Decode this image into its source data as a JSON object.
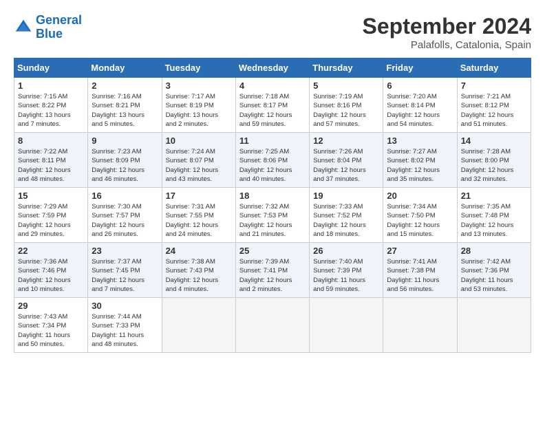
{
  "header": {
    "logo_line1": "General",
    "logo_line2": "Blue",
    "month": "September 2024",
    "location": "Palafolls, Catalonia, Spain"
  },
  "days_of_week": [
    "Sunday",
    "Monday",
    "Tuesday",
    "Wednesday",
    "Thursday",
    "Friday",
    "Saturday"
  ],
  "weeks": [
    [
      {
        "num": "1",
        "info": "Sunrise: 7:15 AM\nSunset: 8:22 PM\nDaylight: 13 hours\nand 7 minutes."
      },
      {
        "num": "2",
        "info": "Sunrise: 7:16 AM\nSunset: 8:21 PM\nDaylight: 13 hours\nand 5 minutes."
      },
      {
        "num": "3",
        "info": "Sunrise: 7:17 AM\nSunset: 8:19 PM\nDaylight: 13 hours\nand 2 minutes."
      },
      {
        "num": "4",
        "info": "Sunrise: 7:18 AM\nSunset: 8:17 PM\nDaylight: 12 hours\nand 59 minutes."
      },
      {
        "num": "5",
        "info": "Sunrise: 7:19 AM\nSunset: 8:16 PM\nDaylight: 12 hours\nand 57 minutes."
      },
      {
        "num": "6",
        "info": "Sunrise: 7:20 AM\nSunset: 8:14 PM\nDaylight: 12 hours\nand 54 minutes."
      },
      {
        "num": "7",
        "info": "Sunrise: 7:21 AM\nSunset: 8:12 PM\nDaylight: 12 hours\nand 51 minutes."
      }
    ],
    [
      {
        "num": "8",
        "info": "Sunrise: 7:22 AM\nSunset: 8:11 PM\nDaylight: 12 hours\nand 48 minutes."
      },
      {
        "num": "9",
        "info": "Sunrise: 7:23 AM\nSunset: 8:09 PM\nDaylight: 12 hours\nand 46 minutes."
      },
      {
        "num": "10",
        "info": "Sunrise: 7:24 AM\nSunset: 8:07 PM\nDaylight: 12 hours\nand 43 minutes."
      },
      {
        "num": "11",
        "info": "Sunrise: 7:25 AM\nSunset: 8:06 PM\nDaylight: 12 hours\nand 40 minutes."
      },
      {
        "num": "12",
        "info": "Sunrise: 7:26 AM\nSunset: 8:04 PM\nDaylight: 12 hours\nand 37 minutes."
      },
      {
        "num": "13",
        "info": "Sunrise: 7:27 AM\nSunset: 8:02 PM\nDaylight: 12 hours\nand 35 minutes."
      },
      {
        "num": "14",
        "info": "Sunrise: 7:28 AM\nSunset: 8:00 PM\nDaylight: 12 hours\nand 32 minutes."
      }
    ],
    [
      {
        "num": "15",
        "info": "Sunrise: 7:29 AM\nSunset: 7:59 PM\nDaylight: 12 hours\nand 29 minutes."
      },
      {
        "num": "16",
        "info": "Sunrise: 7:30 AM\nSunset: 7:57 PM\nDaylight: 12 hours\nand 26 minutes."
      },
      {
        "num": "17",
        "info": "Sunrise: 7:31 AM\nSunset: 7:55 PM\nDaylight: 12 hours\nand 24 minutes."
      },
      {
        "num": "18",
        "info": "Sunrise: 7:32 AM\nSunset: 7:53 PM\nDaylight: 12 hours\nand 21 minutes."
      },
      {
        "num": "19",
        "info": "Sunrise: 7:33 AM\nSunset: 7:52 PM\nDaylight: 12 hours\nand 18 minutes."
      },
      {
        "num": "20",
        "info": "Sunrise: 7:34 AM\nSunset: 7:50 PM\nDaylight: 12 hours\nand 15 minutes."
      },
      {
        "num": "21",
        "info": "Sunrise: 7:35 AM\nSunset: 7:48 PM\nDaylight: 12 hours\nand 13 minutes."
      }
    ],
    [
      {
        "num": "22",
        "info": "Sunrise: 7:36 AM\nSunset: 7:46 PM\nDaylight: 12 hours\nand 10 minutes."
      },
      {
        "num": "23",
        "info": "Sunrise: 7:37 AM\nSunset: 7:45 PM\nDaylight: 12 hours\nand 7 minutes."
      },
      {
        "num": "24",
        "info": "Sunrise: 7:38 AM\nSunset: 7:43 PM\nDaylight: 12 hours\nand 4 minutes."
      },
      {
        "num": "25",
        "info": "Sunrise: 7:39 AM\nSunset: 7:41 PM\nDaylight: 12 hours\nand 2 minutes."
      },
      {
        "num": "26",
        "info": "Sunrise: 7:40 AM\nSunset: 7:39 PM\nDaylight: 11 hours\nand 59 minutes."
      },
      {
        "num": "27",
        "info": "Sunrise: 7:41 AM\nSunset: 7:38 PM\nDaylight: 11 hours\nand 56 minutes."
      },
      {
        "num": "28",
        "info": "Sunrise: 7:42 AM\nSunset: 7:36 PM\nDaylight: 11 hours\nand 53 minutes."
      }
    ],
    [
      {
        "num": "29",
        "info": "Sunrise: 7:43 AM\nSunset: 7:34 PM\nDaylight: 11 hours\nand 50 minutes."
      },
      {
        "num": "30",
        "info": "Sunrise: 7:44 AM\nSunset: 7:33 PM\nDaylight: 11 hours\nand 48 minutes."
      },
      {
        "num": "",
        "info": ""
      },
      {
        "num": "",
        "info": ""
      },
      {
        "num": "",
        "info": ""
      },
      {
        "num": "",
        "info": ""
      },
      {
        "num": "",
        "info": ""
      }
    ]
  ]
}
